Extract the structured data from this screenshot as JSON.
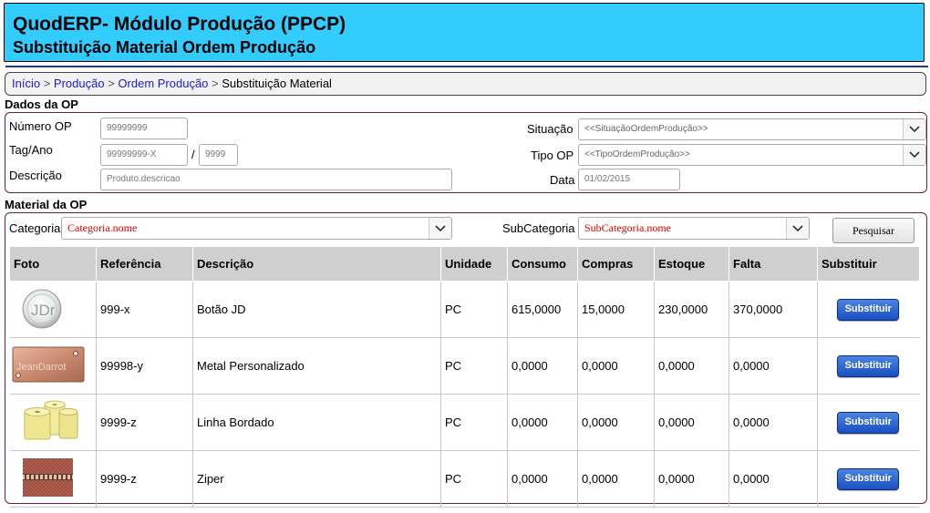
{
  "header": {
    "title": "QuodERP- Módulo Produção (PPCP)",
    "subtitle": "Substituição Material Ordem Produção"
  },
  "breadcrumb": {
    "items": [
      "Início",
      "Produção",
      "Ordem Produção"
    ],
    "separator": ">",
    "current": "Substituição Material"
  },
  "op": {
    "section_title": "Dados da OP",
    "numero_label": "Número OP",
    "numero_placeholder": "99999999",
    "tag_label": "Tag/Ano",
    "tag_placeholder": "99999999-X",
    "slash": "/",
    "ano_placeholder": "9999",
    "descricao_label": "Descrição",
    "descricao_placeholder": "Produto.descricao",
    "situacao_label": "Situação",
    "situacao_value": "<<SituaçãoOrdemProdução>>",
    "tipo_label": "Tipo OP",
    "tipo_value": "<<TipoOrdemProdução>>",
    "data_label": "Data",
    "data_value": "01/02/2015"
  },
  "material": {
    "section_title": "Material da OP",
    "categoria_label": "Categoria",
    "categoria_value": "Categoria.nome",
    "subcategoria_label": "SubCategoria",
    "subcategoria_value": "SubCategoria.nome",
    "pesquisar_label": "Pesquisar",
    "columns": [
      "Foto",
      "Referência",
      "Descrição",
      "Unidade",
      "Consumo",
      "Compras",
      "Estoque",
      "Falta",
      "Substituir"
    ],
    "rows": [
      {
        "photo": "jd-button-photo",
        "referencia": "999-x",
        "descricao": "Botão JD",
        "unidade": "PC",
        "consumo": "615,0000",
        "compras": "15,0000",
        "estoque": "230,0000",
        "falta": "370,0000",
        "action": "Substituir"
      },
      {
        "photo": "metal-plate-photo",
        "referencia": "99998-y",
        "descricao": "Metal Personalizado",
        "unidade": "PC",
        "consumo": "0,0000",
        "compras": "0,0000",
        "estoque": "0,0000",
        "falta": "0,0000",
        "action": "Substituir",
        "photo_text": "JeanDarrot"
      },
      {
        "photo": "thread-spools-photo",
        "referencia": "9999-z",
        "descricao": "Linha Bordado",
        "unidade": "PC",
        "consumo": "0,0000",
        "compras": "0,0000",
        "estoque": "0,0000",
        "falta": "0,0000",
        "action": "Substituir"
      },
      {
        "photo": "zipper-photo",
        "referencia": "9999-z",
        "descricao": "Ziper",
        "unidade": "PC",
        "consumo": "0,0000",
        "compras": "0,0000",
        "estoque": "0,0000",
        "falta": "0,0000",
        "action": "Substituir"
      }
    ]
  },
  "colors": {
    "banner": "#33ccff",
    "link": "#1a1ad6",
    "panel_border": "#6b2040",
    "button": "#1a4fc2",
    "red_value": "#dd0000"
  }
}
